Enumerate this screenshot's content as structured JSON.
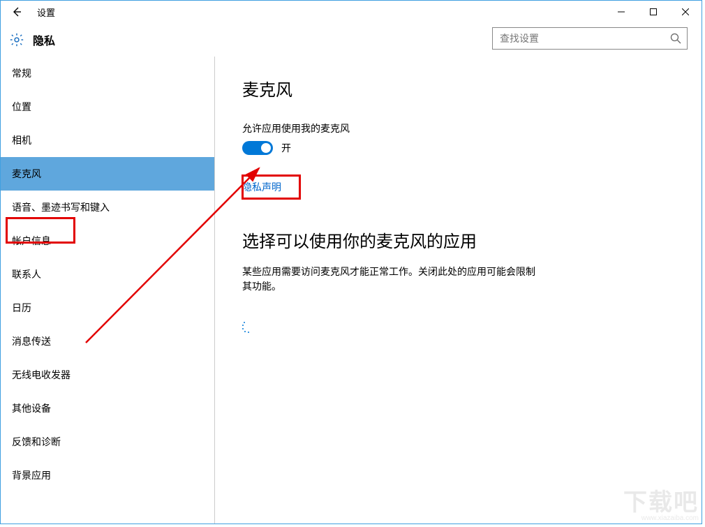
{
  "window": {
    "title": "设置"
  },
  "header": {
    "section_label": "隐私",
    "search_placeholder": "查找设置"
  },
  "sidebar": {
    "items": [
      {
        "label": "常规",
        "selected": false
      },
      {
        "label": "位置",
        "selected": false
      },
      {
        "label": "相机",
        "selected": false
      },
      {
        "label": "麦克风",
        "selected": true
      },
      {
        "label": "语音、墨迹书写和键入",
        "selected": false
      },
      {
        "label": "帐户信息",
        "selected": false
      },
      {
        "label": "联系人",
        "selected": false
      },
      {
        "label": "日历",
        "selected": false
      },
      {
        "label": "消息传送",
        "selected": false
      },
      {
        "label": "无线电收发器",
        "selected": false
      },
      {
        "label": "其他设备",
        "selected": false
      },
      {
        "label": "反馈和诊断",
        "selected": false
      },
      {
        "label": "背景应用",
        "selected": false
      }
    ]
  },
  "content": {
    "heading": "麦克风",
    "allow_label": "允许应用使用我的麦克风",
    "toggle_state_text": "开",
    "toggle_on": true,
    "privacy_link": "隐私声明",
    "choose_heading": "选择可以使用你的麦克风的应用",
    "choose_body": "某些应用需要访问麦克风才能正常工作。关闭此处的应用可能会限制其功能。"
  },
  "watermark": {
    "big": "下载吧",
    "small": "www.xiazaiba.com"
  },
  "colors": {
    "accent": "#0078d7",
    "link": "#0066cc",
    "annotation": "#e20000",
    "selection": "#5fa7dd"
  }
}
